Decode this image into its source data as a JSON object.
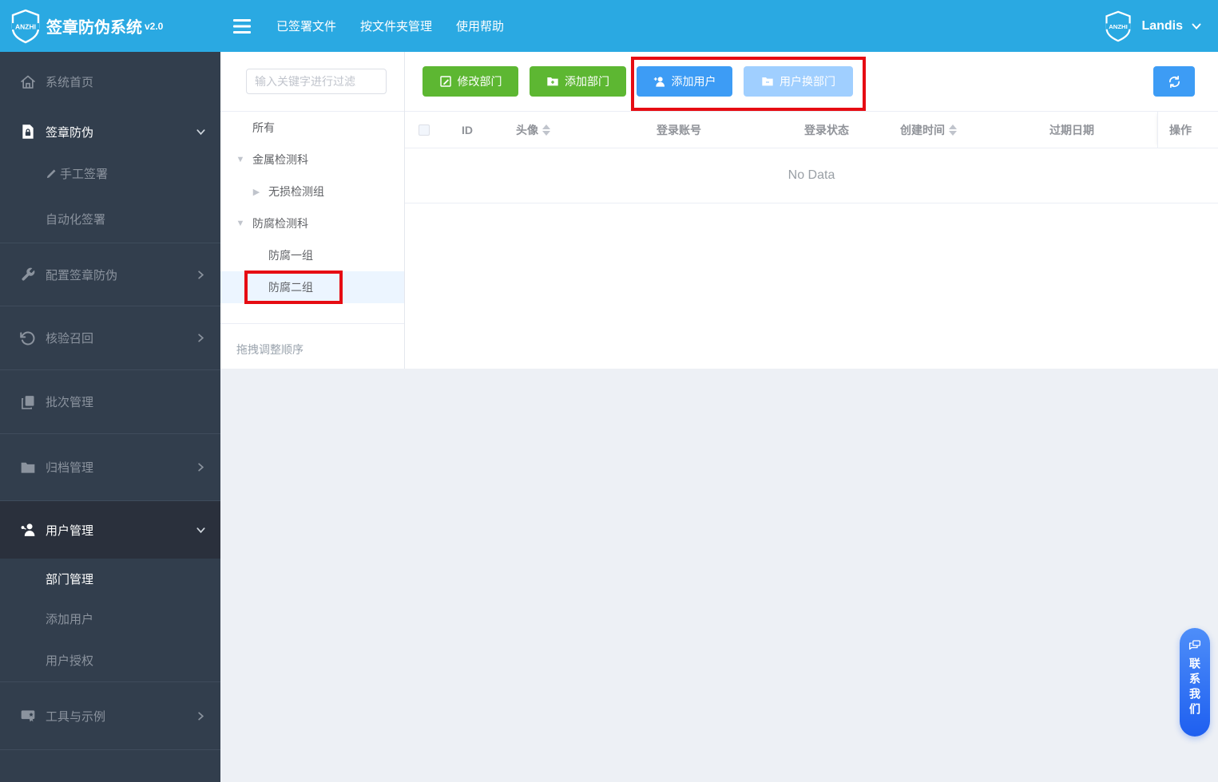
{
  "app": {
    "brand": "ANZHI",
    "title": "签章防伪系统",
    "version": "v2.0"
  },
  "topbar": {
    "nav": [
      {
        "label": "已签署文件"
      },
      {
        "label": "按文件夹管理"
      },
      {
        "label": "使用帮助"
      }
    ],
    "user": {
      "name": "Landis"
    }
  },
  "sidebar": {
    "items": [
      {
        "label": "系统首页"
      },
      {
        "label": "签章防伪"
      },
      {
        "label": "手工签署"
      },
      {
        "label": "自动化签署"
      },
      {
        "label": "配置签章防伪"
      },
      {
        "label": "核验召回"
      },
      {
        "label": "批次管理"
      },
      {
        "label": "归档管理"
      },
      {
        "label": "用户管理"
      },
      {
        "label": "部门管理"
      },
      {
        "label": "添加用户"
      },
      {
        "label": "用户授权"
      },
      {
        "label": "工具与示例"
      }
    ]
  },
  "tree": {
    "filter_placeholder": "输入关键字进行过滤",
    "nodes": [
      {
        "label": "所有"
      },
      {
        "label": "金属检测科"
      },
      {
        "label": "无损检测组"
      },
      {
        "label": "防腐检测科"
      },
      {
        "label": "防腐一组"
      },
      {
        "label": "防腐二组"
      }
    ],
    "selected": "防腐二组",
    "hint": "拖拽调整顺序"
  },
  "toolbar": {
    "buttons": [
      {
        "label": "修改部门"
      },
      {
        "label": "添加部门"
      },
      {
        "label": "添加用户"
      },
      {
        "label": "用户换部门",
        "disabled": true
      }
    ]
  },
  "table": {
    "columns": [
      {
        "label": "ID"
      },
      {
        "label": "头像",
        "sortable": true
      },
      {
        "label": "登录账号"
      },
      {
        "label": "登录状态"
      },
      {
        "label": "创建时间",
        "sortable": true
      },
      {
        "label": "过期日期"
      },
      {
        "label": "操作"
      }
    ],
    "empty_text": "No Data"
  },
  "contact": {
    "label": "联系我们"
  },
  "colors": {
    "topbar_blue": "#2aa9e2",
    "sidebar_dark": "#323e4d",
    "button_green": "#5db732",
    "button_blue": "#3d9cf5",
    "button_blue_disabled": "#a0cfff",
    "annotation_red": "#e60c13",
    "tree_selected_bg": "#ecf5ff"
  }
}
